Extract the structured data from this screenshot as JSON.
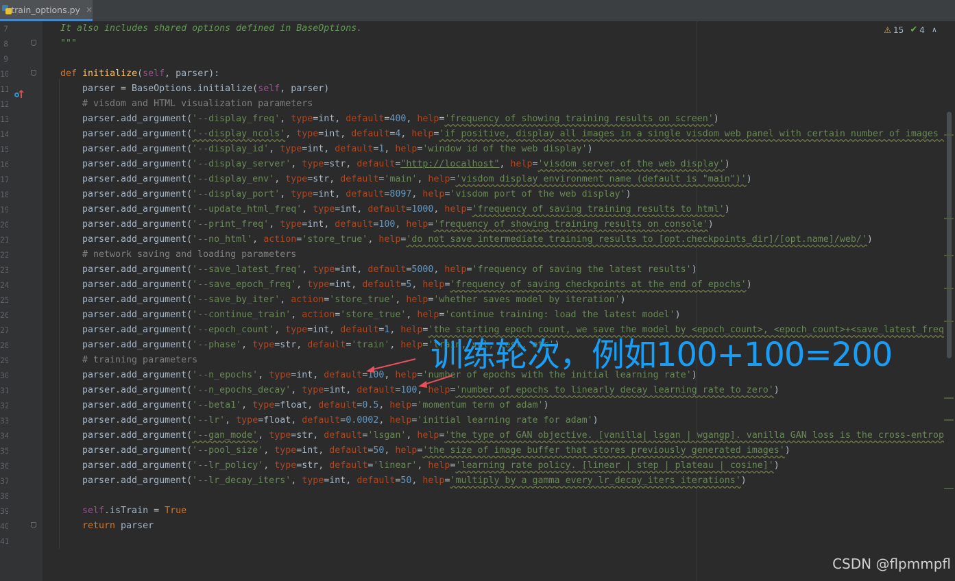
{
  "tab": {
    "file_name": "train_options.py",
    "close_glyph": "×"
  },
  "inspection": {
    "warnings": "15",
    "typos": "4",
    "chevron_up": "∧",
    "chevron_down": "∨",
    "warning_glyph": "⚠",
    "typo_glyph": "✔"
  },
  "line_numbers": [
    "7",
    "8",
    "9",
    "10",
    "11",
    "12",
    "13",
    "14",
    "15",
    "16",
    "17",
    "18",
    "19",
    "20",
    "21",
    "22",
    "23",
    "24",
    "25",
    "26",
    "27",
    "28",
    "29",
    "30",
    "31",
    "32",
    "33",
    "34",
    "35",
    "36",
    "37",
    "38",
    "39",
    "40",
    "41"
  ],
  "code": {
    "l7": "It also includes shared options defined in BaseOptions.",
    "l8": "\"\"\"",
    "l10_def": "def",
    "l10_fn": "initialize",
    "l10_a": "(",
    "l10_self": "self",
    "l10_b": ", parser):",
    "l11_a": "parser = BaseOptions.initialize(",
    "l11_self": "self",
    "l11_b": ", parser)",
    "l12": "# visdom and HTML visualization parameters",
    "l22": "# network saving and loading parameters",
    "l29": "# training parameters",
    "l39_self": "self",
    "l39_b": ".isTrain = ",
    "l39_true": "True",
    "l40_ret": "return",
    "l40_b": " parser",
    "l13": [
      "parser.add_argument(",
      "'--display_freq'",
      ", ",
      "type",
      "=int, ",
      "default",
      "=",
      "400",
      ", ",
      "help",
      "=",
      "'frequency of showing training results on screen'",
      ")"
    ],
    "l14": [
      "parser.add_argument(",
      "'--display_ncols'",
      ", ",
      "type",
      "=int, ",
      "default",
      "=",
      "4",
      ", ",
      "help",
      "=",
      "'if positive, display all images in a single visdom web panel with certain number of images per row.'"
    ],
    "l15": [
      "parser.add_argument(",
      "'--display_id'",
      ", ",
      "type",
      "=int, ",
      "default",
      "=",
      "1",
      ", ",
      "help",
      "=",
      "'window id of the web display'",
      ")"
    ],
    "l16": [
      "parser.add_argument(",
      "'--display_server'",
      ", ",
      "type",
      "=str, ",
      "default",
      "=",
      "\"http://localhost\"",
      ", ",
      "help",
      "=",
      "'visdom server of the web display'",
      ")"
    ],
    "l17": [
      "parser.add_argument(",
      "'--display_env'",
      ", ",
      "type",
      "=str, ",
      "default",
      "=",
      "'main'",
      ", ",
      "help",
      "=",
      "'visdom display environment name (default is \"main\")'",
      ")"
    ],
    "l18": [
      "parser.add_argument(",
      "'--display_port'",
      ", ",
      "type",
      "=int, ",
      "default",
      "=",
      "8097",
      ", ",
      "help",
      "=",
      "'visdom port of the web display'",
      ")"
    ],
    "l19": [
      "parser.add_argument(",
      "'--update_html_freq'",
      ", ",
      "type",
      "=int, ",
      "default",
      "=",
      "1000",
      ", ",
      "help",
      "=",
      "'frequency of saving training results to html'",
      ")"
    ],
    "l20": [
      "parser.add_argument(",
      "'--print_freq'",
      ", ",
      "type",
      "=int, ",
      "default",
      "=",
      "100",
      ", ",
      "help",
      "=",
      "'frequency of showing training results on console'",
      ")"
    ],
    "l21": [
      "parser.add_argument(",
      "'--no_html'",
      ", ",
      "action",
      "=",
      "'store_true'",
      ", ",
      "help",
      "=",
      "'do not save intermediate training results to [opt.checkpoints_dir]/[opt.name]/web/'",
      ")"
    ],
    "l23": [
      "parser.add_argument(",
      "'--save_latest_freq'",
      ", ",
      "type",
      "=int, ",
      "default",
      "=",
      "5000",
      ", ",
      "help",
      "=",
      "'frequency of saving the latest results'",
      ")"
    ],
    "l24": [
      "parser.add_argument(",
      "'--save_epoch_freq'",
      ", ",
      "type",
      "=int, ",
      "default",
      "=",
      "5",
      ", ",
      "help",
      "=",
      "'frequency of saving checkpoints at the end of epochs'",
      ")"
    ],
    "l25": [
      "parser.add_argument(",
      "'--save_by_iter'",
      ", ",
      "action",
      "=",
      "'store_true'",
      ", ",
      "help",
      "=",
      "'whether saves model by iteration'",
      ")"
    ],
    "l26": [
      "parser.add_argument(",
      "'--continue_train'",
      ", ",
      "action",
      "=",
      "'store_true'",
      ", ",
      "help",
      "=",
      "'continue training: load the latest model'",
      ")"
    ],
    "l27": [
      "parser.add_argument(",
      "'--epoch_count'",
      ", ",
      "type",
      "=int, ",
      "default",
      "=",
      "1",
      ", ",
      "help",
      "=",
      "'the starting epoch count, we save the model by <epoch_count>, <epoch_count>+<save_latest_freq>, ...'"
    ],
    "l28": [
      "parser.add_argument(",
      "'--phase'",
      ", ",
      "type",
      "=str, ",
      "default",
      "=",
      "'train'",
      ", ",
      "help",
      "=",
      "'train, val, test, etc'",
      ")"
    ],
    "l30": [
      "parser.add_argument(",
      "'--n_epochs'",
      ", ",
      "type",
      "=int, ",
      "default",
      "=",
      "100",
      ", ",
      "help",
      "=",
      "'number of epochs with the initial learning rate'",
      ")"
    ],
    "l31": [
      "parser.add_argument(",
      "'--n_epochs_decay'",
      ", ",
      "type",
      "=int, ",
      "default",
      "=",
      "100",
      ", ",
      "help",
      "=",
      "'number of epochs to linearly decay learning rate to zero'",
      ")"
    ],
    "l32": [
      "parser.add_argument(",
      "'--beta1'",
      ", ",
      "type",
      "=float, ",
      "default",
      "=",
      "0.5",
      ", ",
      "help",
      "=",
      "'momentum term of adam'",
      ")"
    ],
    "l33": [
      "parser.add_argument(",
      "'--lr'",
      ", ",
      "type",
      "=float, ",
      "default",
      "=",
      "0.0002",
      ", ",
      "help",
      "=",
      "'initial learning rate for adam'",
      ")"
    ],
    "l34": [
      "parser.add_argument(",
      "'--gan_mode'",
      ", ",
      "type",
      "=str, ",
      "default",
      "=",
      "'lsgan'",
      ", ",
      "help",
      "=",
      "'the type of GAN objective. [vanilla| lsgan | wgangp]. vanilla GAN loss is the cross-entropy objective used in the original GAN paper.'"
    ],
    "l35": [
      "parser.add_argument(",
      "'--pool_size'",
      ", ",
      "type",
      "=int, ",
      "default",
      "=",
      "50",
      ", ",
      "help",
      "=",
      "'the size of image buffer that stores previously generated images'",
      ")"
    ],
    "l36": [
      "parser.add_argument(",
      "'--lr_policy'",
      ", ",
      "type",
      "=str, ",
      "default",
      "=",
      "'linear'",
      ", ",
      "help",
      "=",
      "'learning rate policy. [linear | step | plateau | cosine]'",
      ")"
    ],
    "l37": [
      "parser.add_argument(",
      "'--lr_decay_iters'",
      ", ",
      "type",
      "=int, ",
      "default",
      "=",
      "50",
      ", ",
      "help",
      "=",
      "'multiply by a gamma every lr_decay_iters iterations'",
      ")"
    ]
  },
  "annotation_text": "训练轮次，例如100+100=200",
  "watermark": "CSDN @flpmmpfl",
  "colors": {
    "keyword": "#cc7832",
    "string": "#6a8759",
    "number": "#6897bb",
    "param": "#aa4926",
    "comment": "#808080",
    "annotation": "#1a9ef5",
    "arrow": "#e8505b"
  }
}
